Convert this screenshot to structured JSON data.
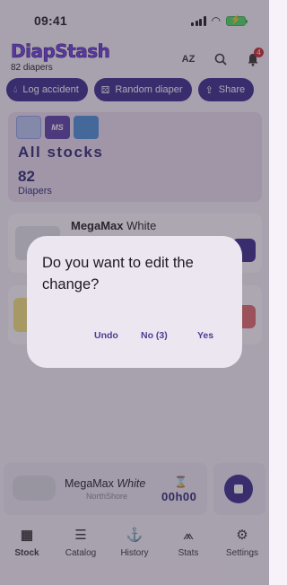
{
  "status_bar": {
    "time": "09:41",
    "battery_icon": "charging-battery-icon"
  },
  "header": {
    "logo": "DiapStash",
    "subtitle": "82 diapers",
    "sort_icon_text": "AZ",
    "notification_count": "4"
  },
  "actions": [
    {
      "label": "Log accident",
      "icon": "drop-icon"
    },
    {
      "label": "Random diaper",
      "icon": "dice-icon"
    },
    {
      "label": "Share",
      "icon": "share-icon"
    }
  ],
  "stocks": {
    "brand_tiles": [
      "",
      "MS",
      ""
    ],
    "title": "All stocks",
    "count": "82",
    "unit": "Diapers"
  },
  "items": [
    {
      "brand": "MegaMax",
      "variant": "White"
    }
  ],
  "current": {
    "brand": "MegaMax",
    "variant": "White",
    "maker": "NorthShore",
    "timer": "00h00"
  },
  "nav": [
    {
      "label": "Stock",
      "icon": "stock-icon"
    },
    {
      "label": "Catalog",
      "icon": "list-icon"
    },
    {
      "label": "History",
      "icon": "history-icon"
    },
    {
      "label": "Stats",
      "icon": "chart-icon"
    },
    {
      "label": "Settings",
      "icon": "gear-icon"
    }
  ],
  "dialog": {
    "message": "Do you want to edit the change?",
    "undo": "Undo",
    "no": "No (3)",
    "yes": "Yes"
  },
  "colors": {
    "primary": "#3a2a8c",
    "logo": "#6f3fe0",
    "surface": "#ece6f0"
  }
}
